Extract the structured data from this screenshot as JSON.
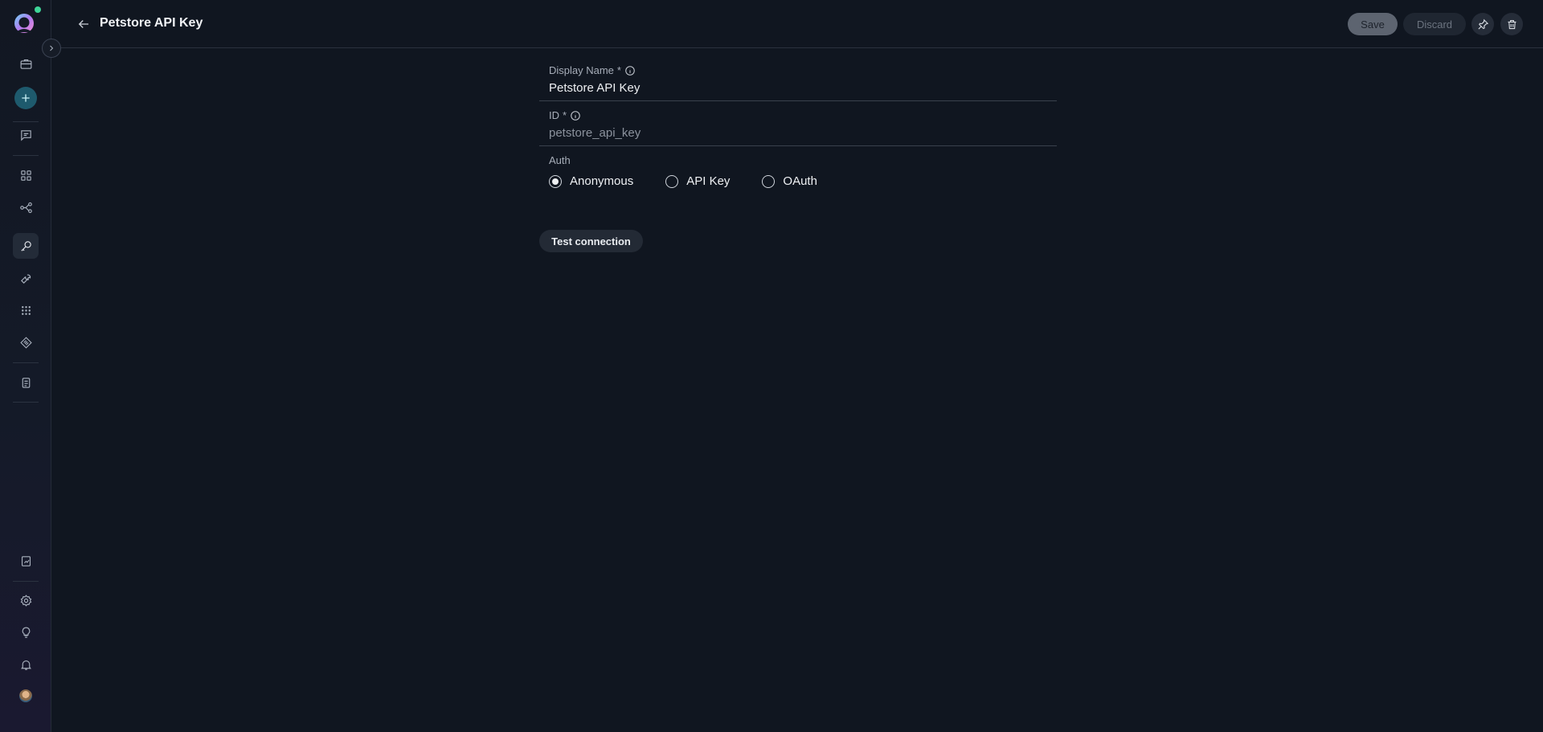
{
  "header": {
    "title": "Petstore API Key",
    "save_label": "Save",
    "discard_label": "Discard"
  },
  "form": {
    "display_name": {
      "label": "Display Name",
      "required": "*",
      "value": "Petstore API Key"
    },
    "id": {
      "label": "ID",
      "required": "*",
      "value": "petstore_api_key"
    },
    "auth": {
      "label": "Auth",
      "options": [
        "Anonymous",
        "API Key",
        "OAuth"
      ],
      "selected": "Anonymous"
    },
    "test_button": "Test connection"
  },
  "sidebar": {
    "icons": [
      "briefcase-icon",
      "plus-icon",
      "chat-icon",
      "grid-icon",
      "flow-icon",
      "key-icon",
      "wrench-icon",
      "apps-icon",
      "tag-icon",
      "clipboard-icon",
      "report-icon",
      "gear-icon",
      "lightbulb-icon",
      "bell-icon",
      "avatar"
    ],
    "active": "key-icon"
  },
  "colors": {
    "background": "#101620",
    "accent_add": "#1e5a6d",
    "status_dot": "#3ed598"
  }
}
